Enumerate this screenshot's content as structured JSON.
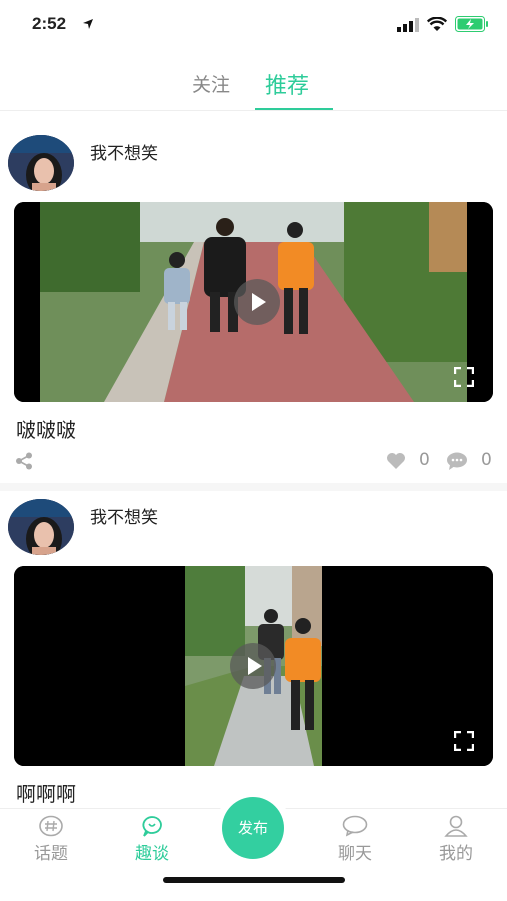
{
  "status": {
    "time": "2:52"
  },
  "tabs": [
    {
      "label": "关注"
    },
    {
      "label": "推荐"
    }
  ],
  "posts": [
    {
      "username": "我不想笑",
      "caption": "啵啵啵",
      "likes": "0",
      "comments": "0"
    },
    {
      "username": "我不想笑",
      "caption": "啊啊啊"
    }
  ],
  "bottom_nav": {
    "items": [
      {
        "label": "话题",
        "icon": "hash-icon"
      },
      {
        "label": "趣谈",
        "icon": "chat-bubble-icon"
      },
      {
        "label": "聊天",
        "icon": "message-icon"
      },
      {
        "label": "我的",
        "icon": "user-icon"
      }
    ],
    "publish_label": "发布"
  },
  "colors": {
    "accent": "#2ecc9a"
  }
}
